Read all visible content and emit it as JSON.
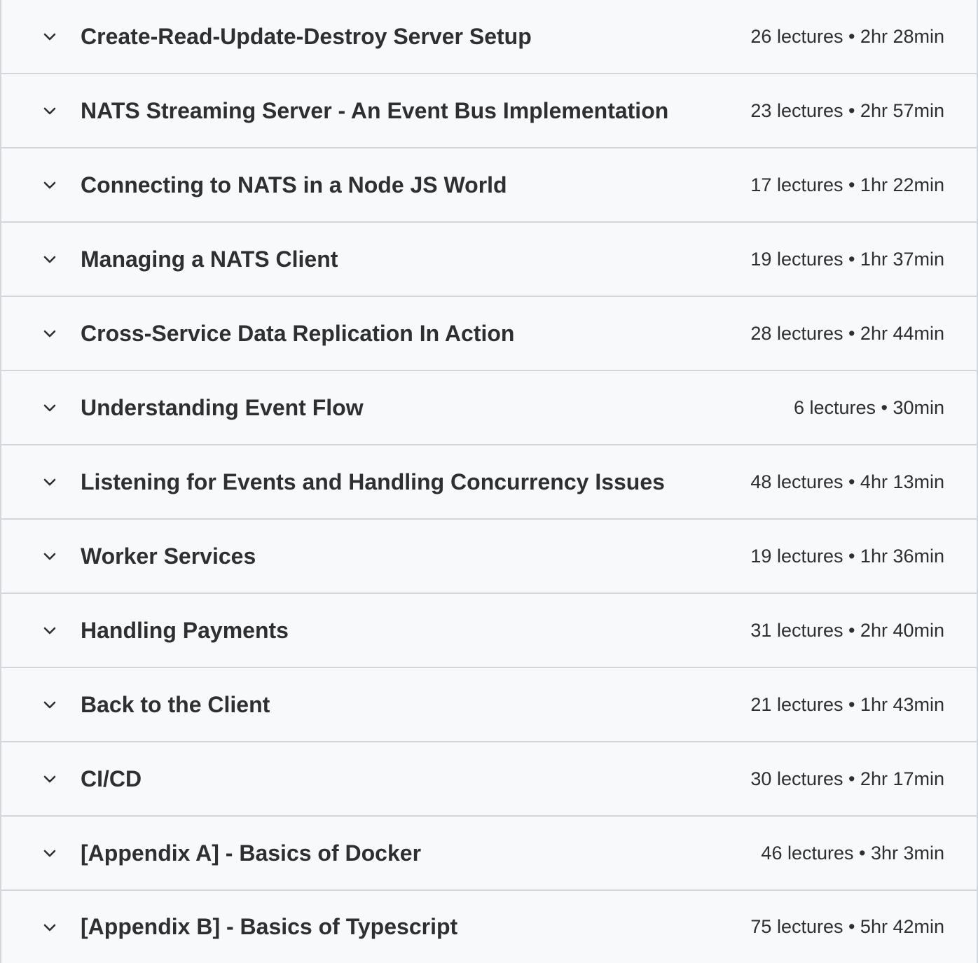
{
  "icons": {
    "expand": "chevron-down-icon"
  },
  "sections": [
    {
      "title": "Create-Read-Update-Destroy Server Setup",
      "meta": "26 lectures • 2hr 28min"
    },
    {
      "title": "NATS Streaming Server - An Event Bus Implementation",
      "meta": "23 lectures • 2hr 57min"
    },
    {
      "title": "Connecting to NATS in a Node JS World",
      "meta": "17 lectures • 1hr 22min"
    },
    {
      "title": "Managing a NATS Client",
      "meta": "19 lectures • 1hr 37min"
    },
    {
      "title": "Cross-Service Data Replication In Action",
      "meta": "28 lectures • 2hr 44min"
    },
    {
      "title": "Understanding Event Flow",
      "meta": "6 lectures • 30min"
    },
    {
      "title": "Listening for Events and Handling Concurrency Issues",
      "meta": "48 lectures • 4hr 13min"
    },
    {
      "title": "Worker Services",
      "meta": "19 lectures • 1hr 36min"
    },
    {
      "title": "Handling Payments",
      "meta": "31 lectures • 2hr 40min"
    },
    {
      "title": "Back to the Client",
      "meta": "21 lectures • 1hr 43min"
    },
    {
      "title": "CI/CD",
      "meta": "30 lectures • 2hr 17min"
    },
    {
      "title": "[Appendix A] - Basics of Docker",
      "meta": "46 lectures • 3hr 3min"
    },
    {
      "title": "[Appendix B] - Basics of Typescript",
      "meta": "75 lectures • 5hr 42min"
    }
  ]
}
